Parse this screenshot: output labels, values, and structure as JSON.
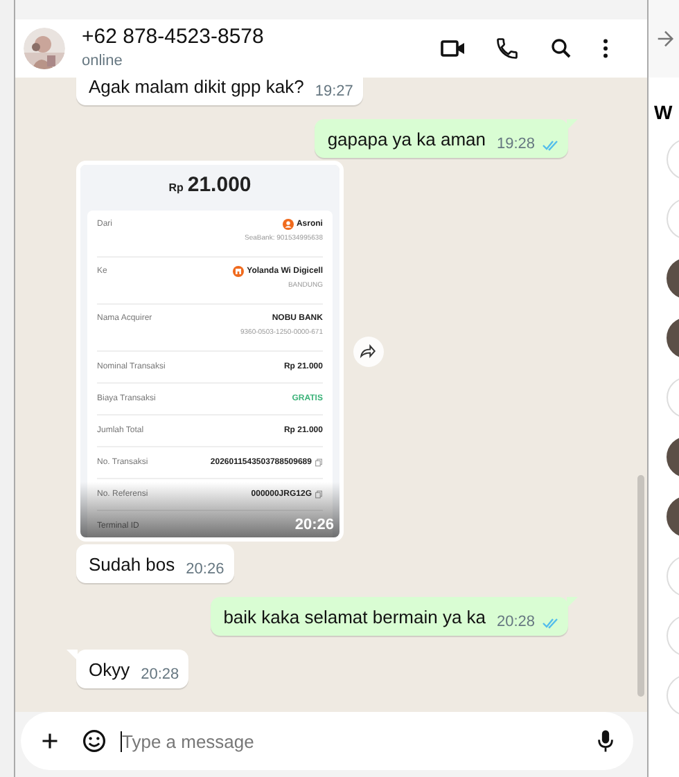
{
  "contact": {
    "name": "+62 878-4523-8578",
    "status": "online"
  },
  "messages": [
    {
      "kind": "text",
      "outgoing": false,
      "tail": false,
      "text": "Agak malam dikit gpp kak?",
      "time": "19:27"
    },
    {
      "kind": "text",
      "outgoing": true,
      "tail": true,
      "text": "gapapa ya ka aman",
      "time": "19:28",
      "read": true
    },
    {
      "kind": "receipt",
      "outgoing": false,
      "tail": false,
      "time": "20:26",
      "receipt": {
        "currency": "Rp",
        "amount": "21.000",
        "rows": [
          {
            "kind": "sender",
            "label": "Dari",
            "value": "Asroni",
            "sub": "SeaBank: 901534995638"
          },
          {
            "kind": "recipient",
            "label": "Ke",
            "value": "Yolanda Wi Digicell",
            "sub": "BANDUNG"
          },
          {
            "kind": "plain",
            "label": "Nama Acquirer",
            "value": "NOBU BANK",
            "sub": "9360-0503-1250-0000-671"
          },
          {
            "kind": "plain",
            "label": "Nominal Transaksi",
            "value": "Rp 21.000"
          },
          {
            "kind": "plain",
            "label": "Biaya Transaksi",
            "value": "GRATIS",
            "color": "#3db37a"
          },
          {
            "kind": "plain",
            "label": "Jumlah Total",
            "value": "Rp 21.000"
          },
          {
            "kind": "copy",
            "label": "No. Transaksi",
            "value": "2026011543503788509689"
          },
          {
            "kind": "copy",
            "label": "No. Referensi",
            "value": "000000JRG12G"
          },
          {
            "kind": "plain",
            "label": "Terminal ID"
          }
        ]
      }
    },
    {
      "kind": "text",
      "outgoing": false,
      "tail": false,
      "text": "Sudah bos",
      "time": "20:26"
    },
    {
      "kind": "text",
      "outgoing": true,
      "tail": true,
      "text": "baik kaka selamat bermain ya ka",
      "time": "20:28",
      "read": true
    },
    {
      "kind": "text",
      "outgoing": false,
      "tail": true,
      "text": "Okyy",
      "time": "20:28"
    }
  ],
  "composer": {
    "placeholder": "Type a message"
  },
  "side_panel": {
    "heading": "W"
  }
}
